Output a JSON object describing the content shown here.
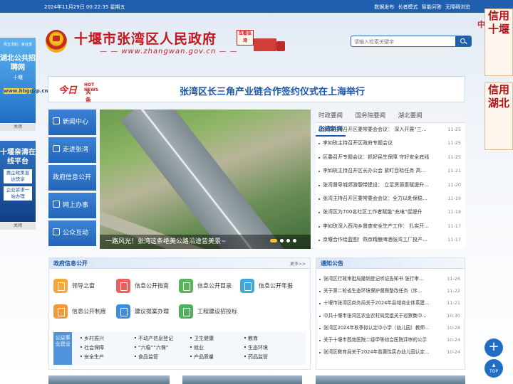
{
  "topbar": {
    "date": "2024年11月29日  00:22:35  星期五",
    "links": [
      "数据发布",
      "长者模式",
      "智能问答",
      "无障碍浏览"
    ]
  },
  "header": {
    "title": "十堰市张湾区人民政府",
    "url": "www.zhangwan.gov.cn",
    "seal_text": "车都张湾",
    "search_placeholder": "请输入检索关键字"
  },
  "left_ads": {
    "ad1": {
      "tagline": "周五求职，就业季",
      "title": "湖北公共招聘网",
      "sub": "十堰",
      "link": "www.hbggzp.cn",
      "close": "关闭"
    },
    "ad2": {
      "title": "十堰亲清在线平台",
      "btn1": "惠企政策直达快享",
      "btn2": "企业诉求一站办理",
      "close": "关闭"
    }
  },
  "right_ads": {
    "ad1": "信用十堰",
    "ad2": "信用湖北",
    "tag": "中国"
  },
  "headline": {
    "logo": "今日",
    "logo_en": "HOT NEWS",
    "logo_sub": "头条",
    "text": "张湾区长三角产业链合作签约仪式在上海举行"
  },
  "nav": [
    "新闻中心",
    "走进张湾",
    "政府信息公开",
    "网上办事",
    "公众互动"
  ],
  "photo_caption": "一路风光！张湾这条绝美公路沿途皆美景~",
  "news": {
    "tabs": [
      "时政要闻",
      "国务院要闻",
      "湖北要闻",
      "张湾新闻"
    ],
    "active_tab": 3,
    "items": [
      {
        "title": "张湾主持召开区委常委会会议： 深入开展“三...",
        "date": "11-25"
      },
      {
        "title": "李如玫主持召开区政府专题会议",
        "date": "11-25"
      },
      {
        "title": "区委召开专题会议：抓好民生保障 守好安全底线",
        "date": "11-25"
      },
      {
        "title": "李如玫主持召开区长办公会 紧盯目标任务 高...",
        "date": "11-21"
      },
      {
        "title": "张湾督导城郊游憩带建设： 立足资源禀赋提升...",
        "date": "11-20"
      },
      {
        "title": "张湾主持召开区委常委会会议：全力以赴保稳...",
        "date": "11-19"
      },
      {
        "title": "张湾区为700名社区工作者赋能“充电”促提升",
        "date": "11-18"
      },
      {
        "title": "李如玫深入西沟乡督查安全生产工作： 扎实开...",
        "date": "11-17"
      },
      {
        "title": "京堰合作绘蓝图！燕京精酿啤酒张湾工厂投产...",
        "date": "11-17"
      }
    ]
  },
  "gov": {
    "title": "政府信息公开",
    "more": "更多>>",
    "items": [
      "领导之窗",
      "信息公开指南",
      "信息公开目录",
      "信息公开年报",
      "信息公开制度",
      "建议提案办理",
      "工程建设招投标"
    ],
    "colors": [
      "#f4a73a",
      "#e9615a",
      "#5bb35c",
      "#3fa8d6",
      "#f29a3b",
      "#3c8ee0",
      "#4fb15e"
    ],
    "public_label": "公益事业建设",
    "public": [
      "乡村振兴",
      "不动产信息登记",
      "卫生健康",
      "教育",
      "社会保障",
      "“六稳”“六保”",
      "就业",
      "生态环境",
      "安全生产",
      "食品监管",
      "产品质量",
      "药品监管"
    ]
  },
  "notice": {
    "title": "通知公告",
    "items": [
      {
        "title": "张湾区行政审批局撤销登记听证告知书 张行审...",
        "date": "11-26"
      },
      {
        "title": "关于第二轮省生态环境保护督察整改任务（序...",
        "date": "11-22"
      },
      {
        "title": "十堰市张湾区商务局关于2024年县域商业体系建...",
        "date": "11-21"
      },
      {
        "title": "中共十堰市张湾区农业农村局党组关于巡察集中...",
        "date": "10-30"
      },
      {
        "title": "张湾区2024年秋季拟认定中小学（幼儿园）教师...",
        "date": "10-28"
      },
      {
        "title": "关于十堰市西苑医院二级甲等综合医院评审的公示",
        "date": "10-24"
      },
      {
        "title": "张湾区教育局关于2024年普惠性民办幼儿园认定...",
        "date": "10-24"
      }
    ]
  },
  "float": {
    "plus": "+",
    "top": "TOP"
  }
}
